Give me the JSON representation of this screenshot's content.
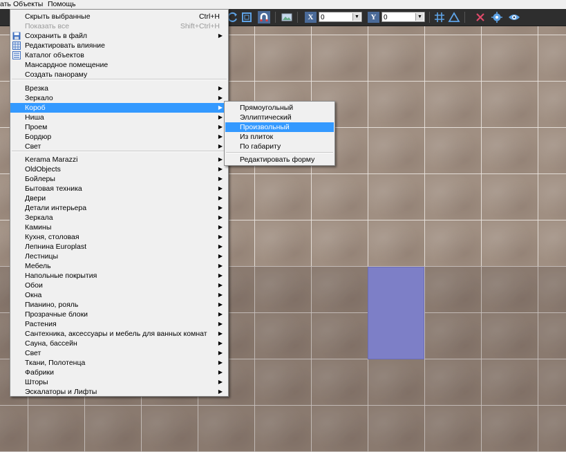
{
  "menubar": {
    "items": [
      "ать",
      "Объекты",
      "Помощь"
    ]
  },
  "toolbar": {
    "x_label": "X",
    "x_value": "0",
    "y_label": "Y",
    "y_value": "0"
  },
  "objects_menu": {
    "items": [
      {
        "label": "Скрыть выбранные",
        "shortcut": "Ctrl+H"
      },
      {
        "label": "Показать все",
        "shortcut": "Shift+Ctrl+H",
        "disabled": true
      },
      {
        "label": "Сохранить в файл",
        "icon": "save-icon",
        "submenu": true
      },
      {
        "label": "Редактировать влияние",
        "icon": "grid-icon"
      },
      {
        "label": "Каталог объектов",
        "icon": "catalog-icon"
      },
      {
        "label": "Мансардное помещение"
      },
      {
        "label": "Создать панораму"
      },
      {
        "label": "Врезка",
        "submenu": true
      },
      {
        "label": "Зеркало",
        "submenu": true
      },
      {
        "label": "Короб",
        "submenu": true,
        "highlighted": true
      },
      {
        "label": "Ниша",
        "submenu": true
      },
      {
        "label": "Проем",
        "submenu": true
      },
      {
        "label": "Бордюр",
        "submenu": true
      },
      {
        "label": "Свет",
        "submenu": true
      },
      {
        "label": "Kerama Marazzi",
        "submenu": true
      },
      {
        "label": "OldObjects",
        "submenu": true
      },
      {
        "label": "Бойлеры",
        "submenu": true
      },
      {
        "label": "Бытовая техника",
        "submenu": true
      },
      {
        "label": "Двери",
        "submenu": true
      },
      {
        "label": "Детали интерьера",
        "submenu": true
      },
      {
        "label": "Зеркала",
        "submenu": true
      },
      {
        "label": "Камины",
        "submenu": true
      },
      {
        "label": "Кухня, столовая",
        "submenu": true
      },
      {
        "label": "Лепнина Europlast",
        "submenu": true
      },
      {
        "label": "Лестницы",
        "submenu": true
      },
      {
        "label": "Мебель",
        "submenu": true
      },
      {
        "label": "Напольные покрытия",
        "submenu": true
      },
      {
        "label": "Обои",
        "submenu": true
      },
      {
        "label": "Окна",
        "submenu": true
      },
      {
        "label": "Пианино, рояль",
        "submenu": true
      },
      {
        "label": "Прозрачные блоки",
        "submenu": true
      },
      {
        "label": "Растения",
        "submenu": true
      },
      {
        "label": "Сантехника, аксессуары и мебель для ванных комнат",
        "submenu": true
      },
      {
        "label": "Сауна, бассейн",
        "submenu": true
      },
      {
        "label": "Свет",
        "submenu": true
      },
      {
        "label": "Ткани, Полотенца",
        "submenu": true
      },
      {
        "label": "Фабрики",
        "submenu": true
      },
      {
        "label": "Шторы",
        "submenu": true
      },
      {
        "label": "Эскалаторы и Лифты",
        "submenu": true
      }
    ]
  },
  "korob_submenu": {
    "items": [
      {
        "label": "Прямоугольный"
      },
      {
        "label": "Эллиптический"
      },
      {
        "label": "Произвольный",
        "highlighted": true
      },
      {
        "label": "Из плиток"
      },
      {
        "label": "По габариту"
      },
      {
        "label": "Редактировать форму"
      }
    ]
  },
  "colors": {
    "menu_highlight": "#3399ff",
    "selected_tile": "#7d7fc7",
    "tile": "#a08f82"
  }
}
